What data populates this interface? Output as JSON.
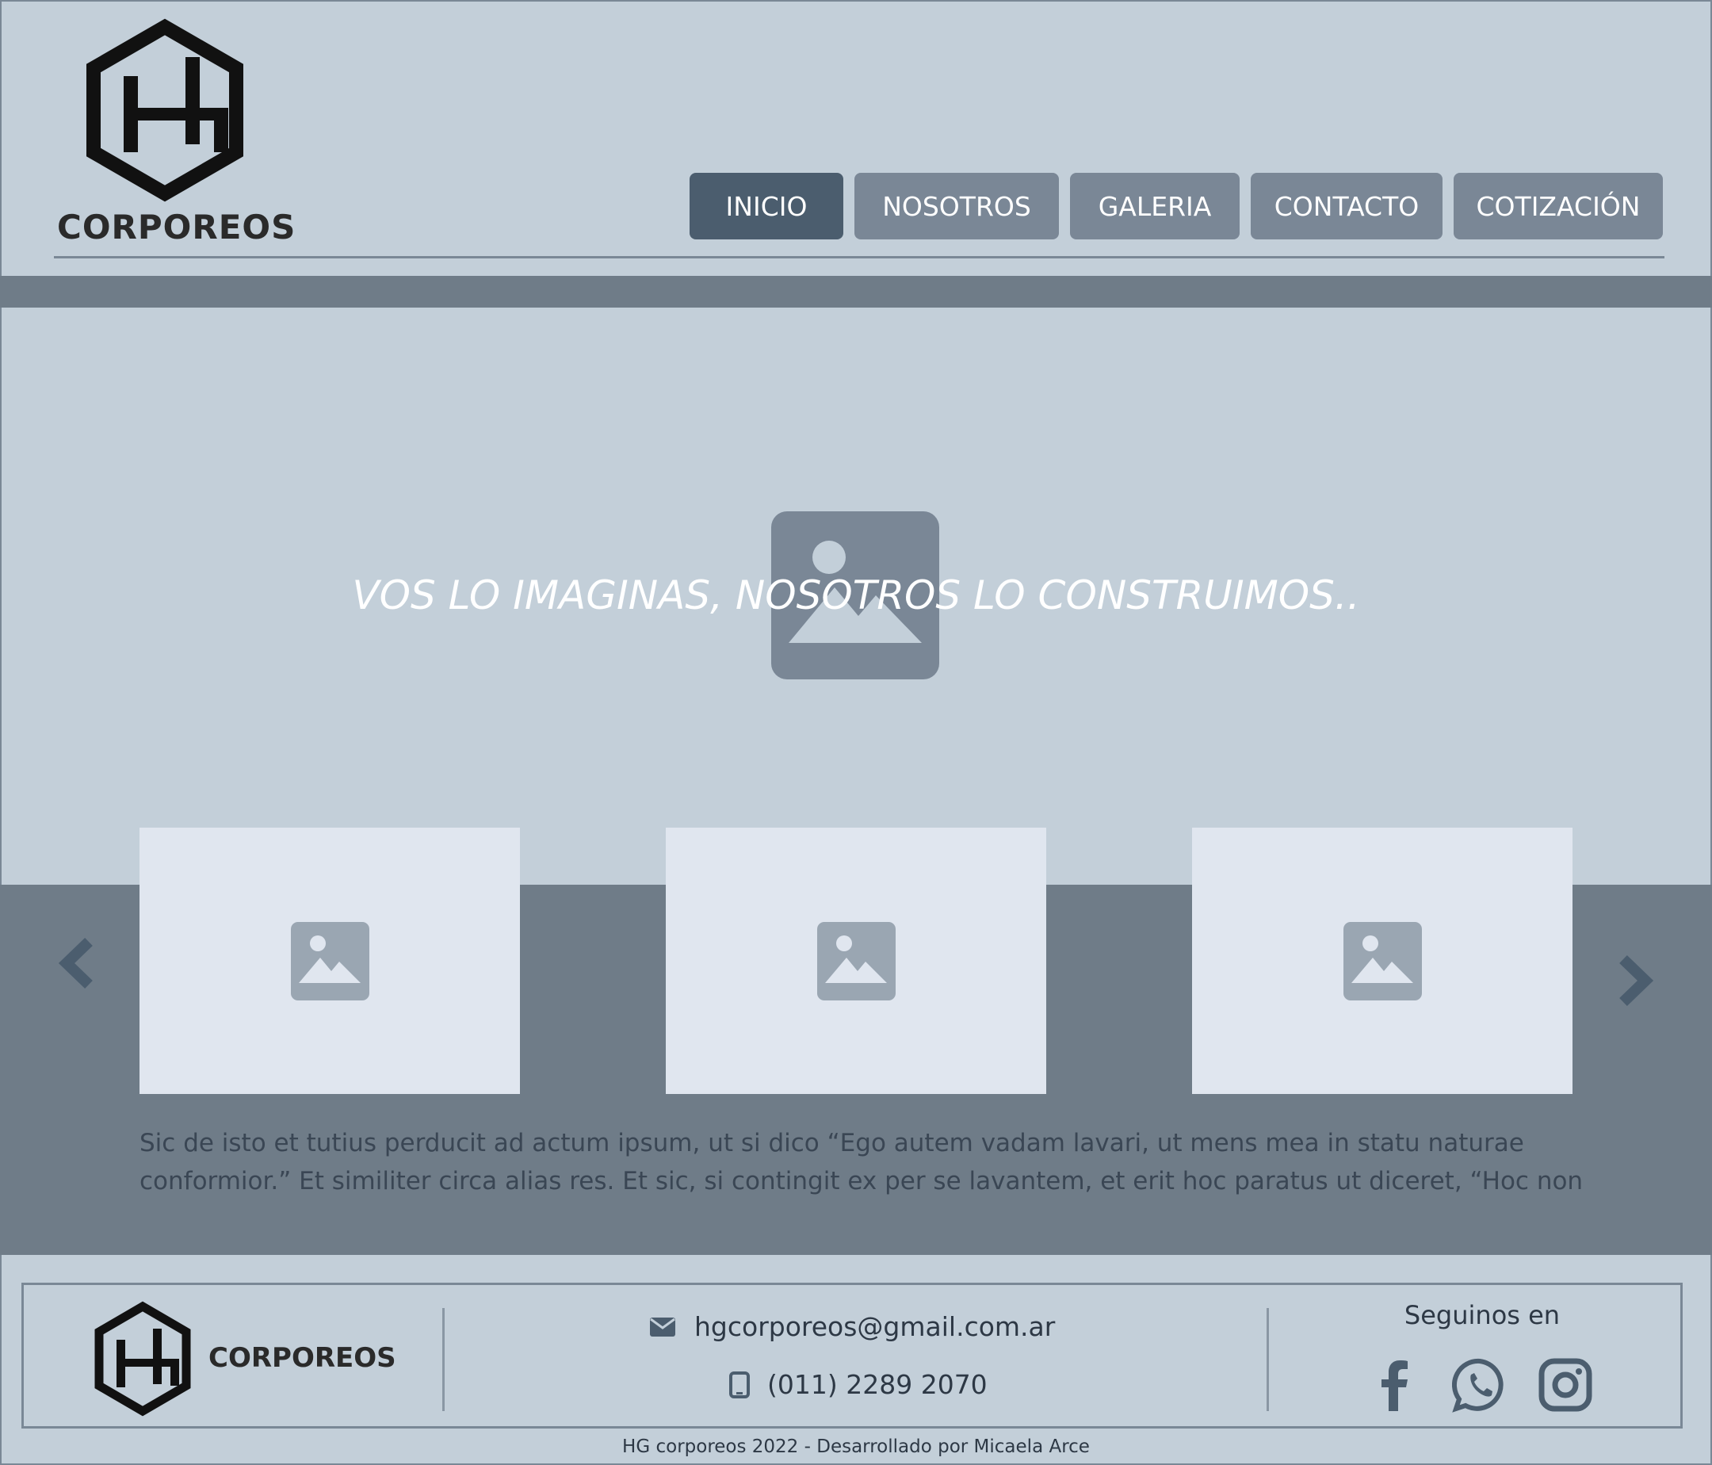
{
  "brand": {
    "name": "CORPOREOS",
    "monogram": "HG"
  },
  "nav": [
    {
      "label": "INICIO",
      "active": true
    },
    {
      "label": "NOSOTROS",
      "active": false
    },
    {
      "label": "GALERIA",
      "active": false
    },
    {
      "label": "CONTACTO",
      "active": false
    },
    {
      "label": "COTIZACIÓN",
      "active": false
    }
  ],
  "hero": {
    "tagline": "VOS LO IMAGINAS, NOSOTROS LO CONSTRUIMOS.."
  },
  "carousel": {
    "description": "Sic de isto et tutius perducit ad actum ipsum, ut si dico “Ego autem vadam lavari, ut mens mea in statu naturae conformior.” Et similiter circa alias res. Et sic, si contingit ex per se lavantem, et erit hoc paratus ut diceret, “Hoc non"
  },
  "footer": {
    "email": "hgcorporeos@gmail.com.ar",
    "phone": "(011) 2289 2070",
    "social_title": "Seguinos en",
    "social_icons": [
      "facebook-icon",
      "whatsapp-icon",
      "instagram-icon"
    ],
    "credits": "HG corporeos 2022 - Desarrollado por Micaela Arce"
  },
  "colors": {
    "background": "#c3cfd9",
    "nav_default": "#7a8796",
    "nav_active": "#4b5d6e",
    "band": "#6f7c88",
    "card": "#e0e6ef"
  }
}
